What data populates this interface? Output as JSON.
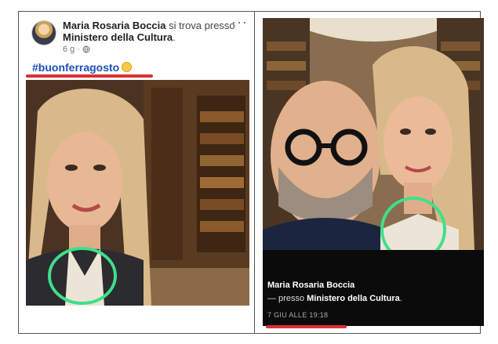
{
  "left_post": {
    "author": "Maria Rosaria Boccia",
    "connector": " si trova presso ",
    "place": "Ministero della Cultura",
    "period": ".",
    "time": "6 g",
    "dot": "·",
    "globe_icon": "globe-icon",
    "more_icon": "more-icon",
    "hashtag": "#buonferragosto",
    "highlight_color": "#e03030",
    "circle_color": "#3ee08a"
  },
  "right_post": {
    "author": "Maria Rosaria Boccia",
    "place_prefix": "— presso ",
    "place": "Ministero della Cultura",
    "period": ".",
    "date": "7 GIU ALLE 19:18",
    "highlight_color": "#e03030",
    "circle_color": "#3ee08a"
  }
}
